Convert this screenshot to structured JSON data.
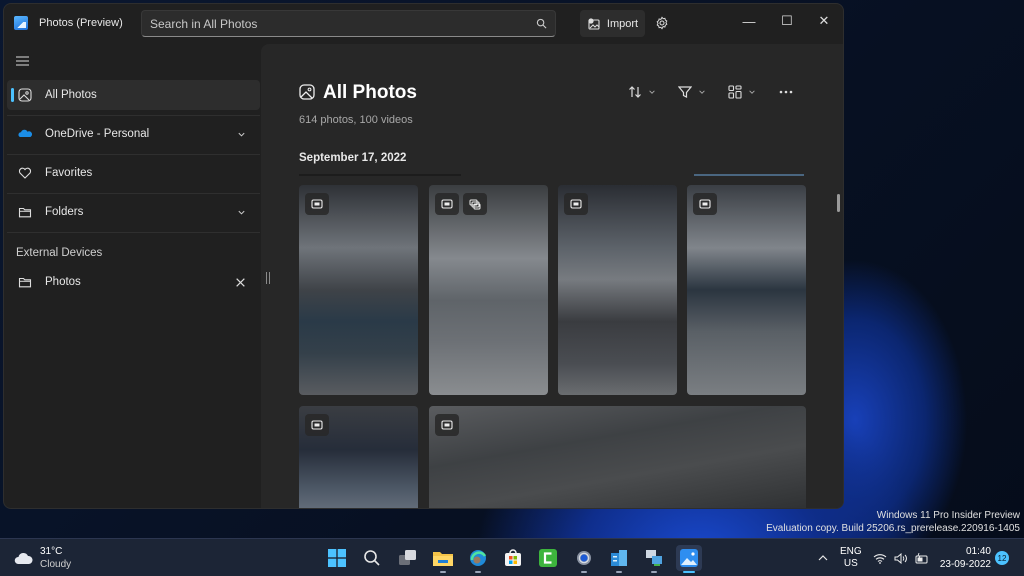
{
  "window": {
    "app_title": "Photos (Preview)",
    "search_placeholder": "Search in All Photos",
    "import_label": "Import",
    "controls": {
      "minimize": "—",
      "maximize": "☐",
      "close": "✕"
    }
  },
  "sidebar": {
    "items": [
      {
        "label": "All Photos",
        "icon": "all-photos-icon",
        "active": true
      },
      {
        "label": "OneDrive - Personal",
        "icon": "onedrive-icon",
        "expandable": true
      },
      {
        "label": "Favorites",
        "icon": "heart-icon"
      },
      {
        "label": "Folders",
        "icon": "folder-icon",
        "expandable": true
      }
    ],
    "external_section_label": "External Devices",
    "external_items": [
      {
        "label": "Photos",
        "icon": "folder-icon",
        "removable": true
      }
    ]
  },
  "main": {
    "title": "All Photos",
    "counts": "614 photos, 100 videos",
    "date_group": "September 17, 2022",
    "toolbar": [
      "sort-icon",
      "filter-icon",
      "view-layout-icon",
      "more-icon"
    ],
    "thumbnails": [
      {
        "type": "video",
        "scene": "gym-back-view"
      },
      {
        "type": "video",
        "extra_badge": "burst-icon",
        "scene": "gym-dumbbell-row"
      },
      {
        "type": "video",
        "scene": "gym-bench-press"
      },
      {
        "type": "video",
        "scene": "gym-cable-curl"
      },
      {
        "type": "video",
        "scene": "gym-hall"
      },
      {
        "type": "video",
        "scene": "gym-ceiling"
      }
    ]
  },
  "desktop": {
    "watermark_line1": "Windows 11 Pro Insider Preview",
    "watermark_line2": "Evaluation copy. Build 25206.rs_prerelease.220916-1405"
  },
  "taskbar": {
    "weather_temp": "31°C",
    "weather_condition": "Cloudy",
    "apps": [
      "start",
      "search",
      "task-view",
      "file-explorer",
      "edge",
      "store",
      "camtasia",
      "settings",
      "azure-data-studio",
      "remote-desktop",
      "photos"
    ],
    "language_line1": "ENG",
    "language_line2": "US",
    "time": "01:40",
    "date": "23-09-2022",
    "notification_count": "12",
    "colors": {
      "accent": "#4cc2ff"
    }
  }
}
